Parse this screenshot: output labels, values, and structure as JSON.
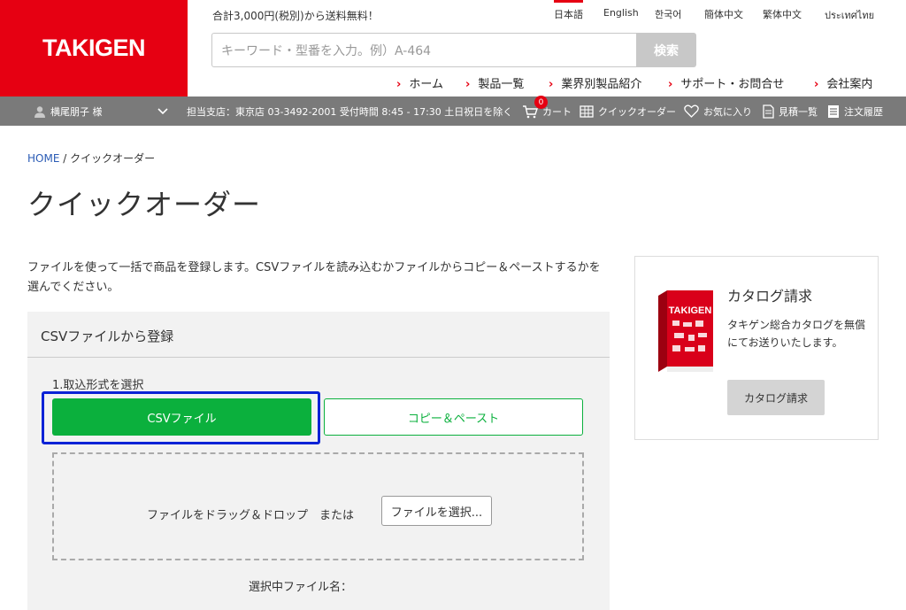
{
  "header": {
    "logo": "TAKIGEN",
    "promo": "合計3,000円(税別)から送料無料！",
    "languages": [
      "日本語",
      "English",
      "한국어",
      "簡体中文",
      "繁体中文",
      "ประเทศไทย"
    ],
    "active_language": "日本語",
    "search": {
      "placeholder": "キーワード・型番を入力。例）A-464",
      "button": "検索"
    },
    "nav": [
      "ホーム",
      "製品一覧",
      "業界別製品紹介",
      "サポート・お問合せ",
      "会社案内"
    ]
  },
  "userbar": {
    "user": "横尾朋子 様",
    "branch_info": "担当支店：東京店 03-3492-2001 受付時間 8:45 - 17:30 土日祝日を除く",
    "cart": "カート",
    "cart_count": "0",
    "quick_order": "クイックオーダー",
    "favorites": "お気に入り",
    "estimates": "見積一覧",
    "order_history": "注文履歴"
  },
  "breadcrumb": {
    "home": "HOME",
    "separator": "/",
    "current": "クイックオーダー"
  },
  "page_title": "クイックオーダー",
  "intro": "ファイルを使って一括で商品を登録します。CSVファイルを読み込むかファイルからコピー＆ペーストするかを選んでください。",
  "csv_panel": {
    "heading": "CSVファイルから登録",
    "step": "1.取込形式を選択",
    "option_csv": "CSVファイル",
    "option_paste": "コピー＆ペースト",
    "drop_text": "ファイルをドラッグ＆ドロップ　または",
    "choose_button": "ファイルを選択...",
    "selected_label": "選択中ファイル名："
  },
  "catalog": {
    "title": "カタログ請求",
    "description": "タキゲン総合カタログを無償にてお送りいたします。",
    "button": "カタログ請求",
    "book_brand": "TAKIGEN"
  },
  "colors": {
    "brand_red": "#e60012",
    "green": "#0bb03d",
    "focus_blue": "#0b22d6",
    "userbar_gray": "#7a7a7a"
  }
}
